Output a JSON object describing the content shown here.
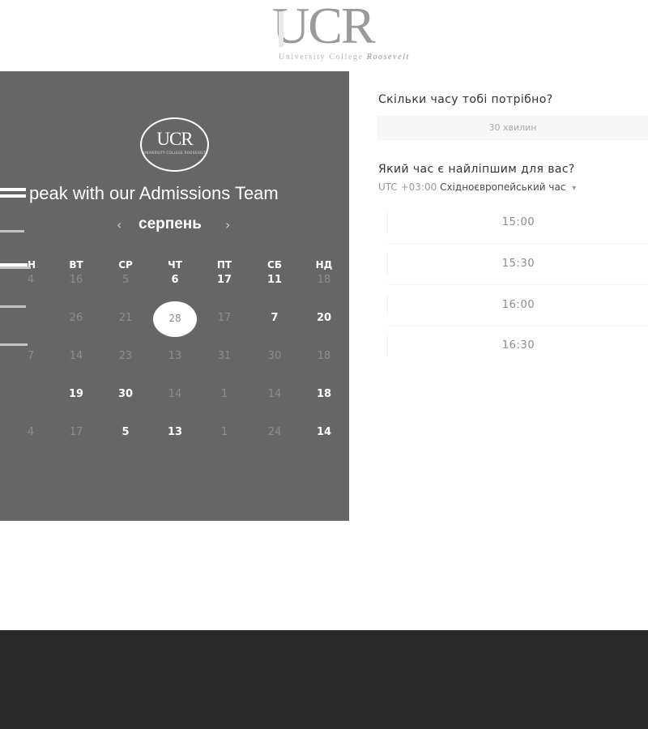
{
  "logo": {
    "mark": "UCR",
    "tagline": "University College",
    "tagline_accent": "Roosevelt"
  },
  "panel": {
    "logo_mark": "UCR",
    "logo_tag": "UNIVERSITY COLLEGE ROOSEVELT",
    "title": "peak with our Admissions Team",
    "month": "серпень",
    "prev_icon": "‹",
    "next_icon": "›",
    "weekdays": [
      "Н",
      "ВТ",
      "СР",
      "ЧТ",
      "ПТ",
      "СБ",
      "НД"
    ],
    "weeks": [
      [
        {
          "day": "4",
          "active": false
        },
        {
          "day": "16",
          "active": false
        },
        {
          "day": "5",
          "active": false
        },
        {
          "day": "6",
          "active": true
        },
        {
          "day": "17",
          "active": true
        },
        {
          "day": "11",
          "active": true
        },
        {
          "day": "18",
          "active": false
        }
      ],
      [
        {
          "day": "",
          "active": false
        },
        {
          "day": "26",
          "active": false
        },
        {
          "day": "21",
          "active": false
        },
        {
          "day": "28",
          "active": false,
          "selected": true
        },
        {
          "day": "17",
          "active": false
        },
        {
          "day": "7",
          "active": true
        },
        {
          "day": "20",
          "active": true
        }
      ],
      [
        {
          "day": "7",
          "active": false
        },
        {
          "day": "14",
          "active": false
        },
        {
          "day": "23",
          "active": false
        },
        {
          "day": "13",
          "active": false
        },
        {
          "day": "31",
          "active": false
        },
        {
          "day": "30",
          "active": false
        },
        {
          "day": "18",
          "active": false
        }
      ],
      [
        {
          "day": "",
          "active": false
        },
        {
          "day": "19",
          "active": true
        },
        {
          "day": "30",
          "active": true
        },
        {
          "day": "14",
          "active": false
        },
        {
          "day": "1",
          "active": false
        },
        {
          "day": "14",
          "active": false
        },
        {
          "day": "18",
          "active": true
        }
      ],
      [
        {
          "day": "4",
          "active": false
        },
        {
          "day": "17",
          "active": false
        },
        {
          "day": "5",
          "active": true
        },
        {
          "day": "13",
          "active": true
        },
        {
          "day": "1",
          "active": false
        },
        {
          "day": "24",
          "active": false
        },
        {
          "day": "14",
          "active": true
        }
      ]
    ]
  },
  "booking": {
    "duration_question": "Скільки часу тобі потрібно?",
    "duration_value": "30 хвилин",
    "time_question": "Який час є найліпшим для вас?",
    "tz_offset": "UTC +03:00",
    "tz_name": "Східноєвропейський час",
    "tz_chevron": "▾",
    "slots": [
      "15:00",
      "15:30",
      "16:00",
      "16:30"
    ]
  }
}
